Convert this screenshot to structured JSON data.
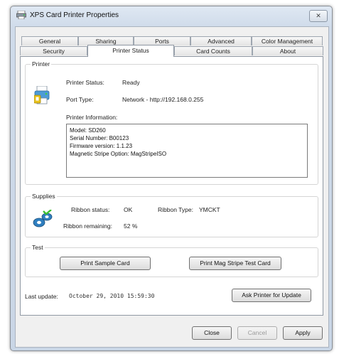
{
  "window": {
    "title": "XPS Card Printer Properties",
    "close_glyph": "✕"
  },
  "tabs": {
    "row1": [
      "General",
      "Sharing",
      "Ports",
      "Advanced",
      "Color Management"
    ],
    "row2": [
      "Security",
      "Printer Status",
      "Card Counts",
      "About"
    ],
    "active": "Printer Status"
  },
  "printer": {
    "group_label": "Printer",
    "status_label": "Printer Status:",
    "status_value": "Ready",
    "port_label": "Port Type:",
    "port_value": "Network - http://192.168.0.255",
    "info_label": "Printer Information:",
    "info_lines": [
      "Model: SD260",
      "Serial Number: B00123",
      "Firmware version: 1.1.23",
      "Magnetic Stripe Option: MagStripeISO"
    ]
  },
  "supplies": {
    "group_label": "Supplies",
    "ribbon_status_label": "Ribbon status:",
    "ribbon_status_value": "OK",
    "ribbon_type_label": "Ribbon Type:",
    "ribbon_type_value": "YMCKT",
    "ribbon_remaining_label": "Ribbon remaining:",
    "ribbon_remaining_value": "52 %"
  },
  "test": {
    "group_label": "Test",
    "sample_button": "Print Sample Card",
    "mag_button": "Print Mag Stripe Test Card"
  },
  "update": {
    "label": "Last update:",
    "value": "October 29, 2010 15:59:30",
    "button": "Ask Printer for Update"
  },
  "footer": {
    "close": "Close",
    "cancel": "Cancel",
    "apply": "Apply"
  },
  "icons": {
    "app": "printer-icon",
    "printer": "printer-status-icon",
    "supplies": "supplies-icon"
  }
}
